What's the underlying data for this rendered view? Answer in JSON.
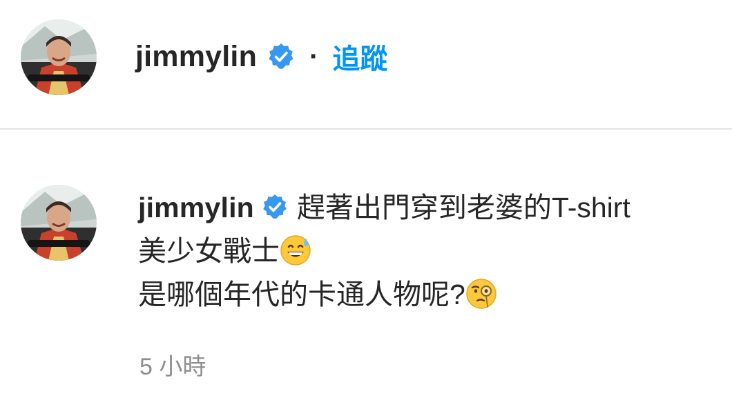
{
  "header": {
    "username": "jimmylin",
    "separator": "·",
    "follow_label": "追蹤"
  },
  "comment": {
    "username": "jimmylin",
    "text_line1": "趕著出門穿到老婆的T-shirt",
    "text_line2": "美少女戰士",
    "text_line3": "是哪個年代的卡通人物呢?",
    "emoji_line2": "grinning-face-with-sweat-emoji",
    "emoji_line3": "face-with-monocle-emoji",
    "timestamp": "5 小時"
  },
  "colors": {
    "link_blue": "#0095f6",
    "verified_blue": "#3897f0",
    "text_primary": "#262626",
    "text_secondary": "#8e8e8e",
    "divider": "#e3e3e3"
  }
}
